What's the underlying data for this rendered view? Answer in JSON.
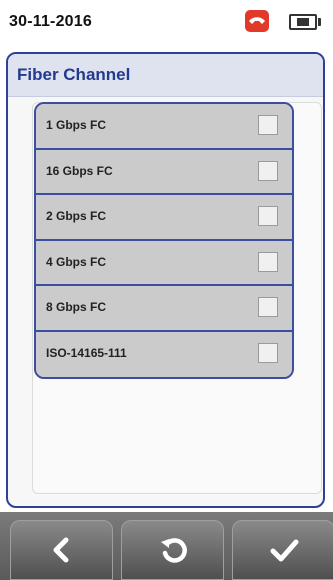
{
  "status": {
    "date": "30-11-2016",
    "icons": [
      "phone-hangup-icon",
      "battery-icon"
    ],
    "accent_color": "#e23a2a"
  },
  "panel": {
    "title": "Fiber Channel",
    "title_color": "#233b8f"
  },
  "options": [
    {
      "label": "1 Gbps FC",
      "checked": false
    },
    {
      "label": "16 Gbps FC",
      "checked": false
    },
    {
      "label": "2 Gbps FC",
      "checked": false
    },
    {
      "label": "4 Gbps FC",
      "checked": false
    },
    {
      "label": "8 Gbps FC",
      "checked": false
    },
    {
      "label": "ISO-14165-111",
      "checked": false
    }
  ],
  "bottom_nav": {
    "buttons": [
      "back-icon",
      "undo-icon",
      "check-icon"
    ]
  }
}
